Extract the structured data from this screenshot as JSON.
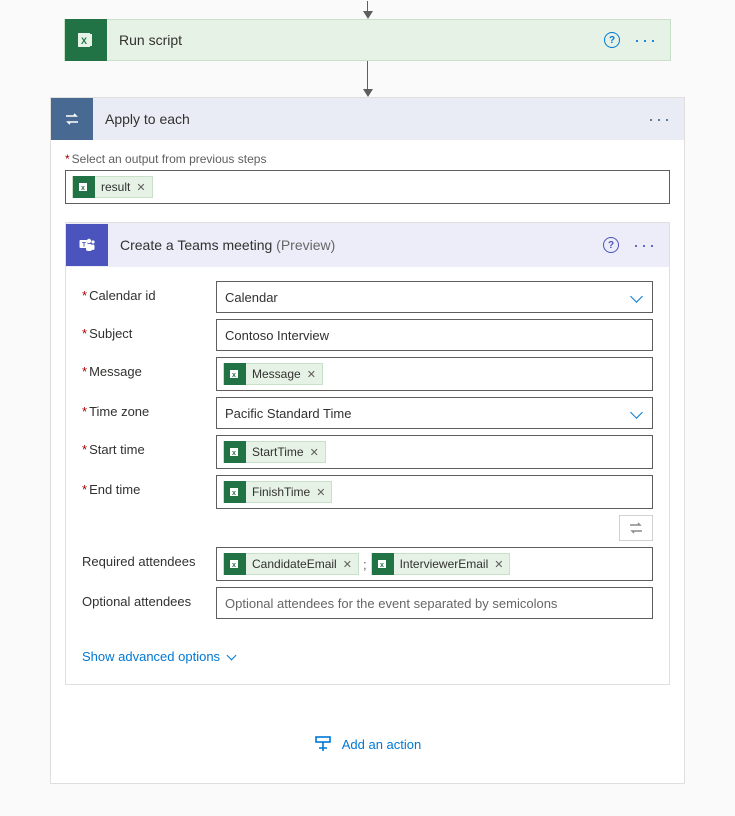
{
  "run_script": {
    "title": "Run script",
    "icon": "excel-icon"
  },
  "apply_to_each": {
    "title": "Apply to each",
    "icon": "loop-icon",
    "select_output_label": "Select an output from previous steps",
    "output_tokens": [
      {
        "label": "result",
        "icon": "excel-icon"
      }
    ]
  },
  "teams_meeting": {
    "title": "Create a Teams meeting",
    "preview_tag": "(Preview)",
    "icon": "teams-icon",
    "fields": {
      "calendar_id": {
        "label": "Calendar id",
        "value": "Calendar",
        "required": true,
        "type": "select"
      },
      "subject": {
        "label": "Subject",
        "value": "Contoso Interview",
        "required": true,
        "type": "text"
      },
      "message": {
        "label": "Message",
        "tokens": [
          {
            "label": "Message",
            "icon": "excel-icon"
          }
        ],
        "required": true,
        "type": "token"
      },
      "time_zone": {
        "label": "Time zone",
        "value": "Pacific Standard Time",
        "required": true,
        "type": "select"
      },
      "start_time": {
        "label": "Start time",
        "tokens": [
          {
            "label": "StartTime",
            "icon": "excel-icon"
          }
        ],
        "required": true,
        "type": "token"
      },
      "end_time": {
        "label": "End time",
        "tokens": [
          {
            "label": "FinishTime",
            "icon": "excel-icon"
          }
        ],
        "required": true,
        "type": "token"
      },
      "required_attendees": {
        "label": "Required attendees",
        "tokens": [
          {
            "label": "CandidateEmail",
            "icon": "excel-icon"
          },
          {
            "label": "InterviewerEmail",
            "icon": "excel-icon"
          }
        ],
        "separator": ";",
        "required": false,
        "type": "token"
      },
      "optional_attendees": {
        "label": "Optional attendees",
        "placeholder": "Optional attendees for the event separated by semicolons",
        "required": false,
        "type": "text"
      }
    },
    "advanced_link": "Show advanced options"
  },
  "add_action": {
    "label": "Add an action"
  },
  "colors": {
    "excel": "#217346",
    "teams": "#4b53bc",
    "loop": "#486991",
    "link": "#0078d4"
  }
}
